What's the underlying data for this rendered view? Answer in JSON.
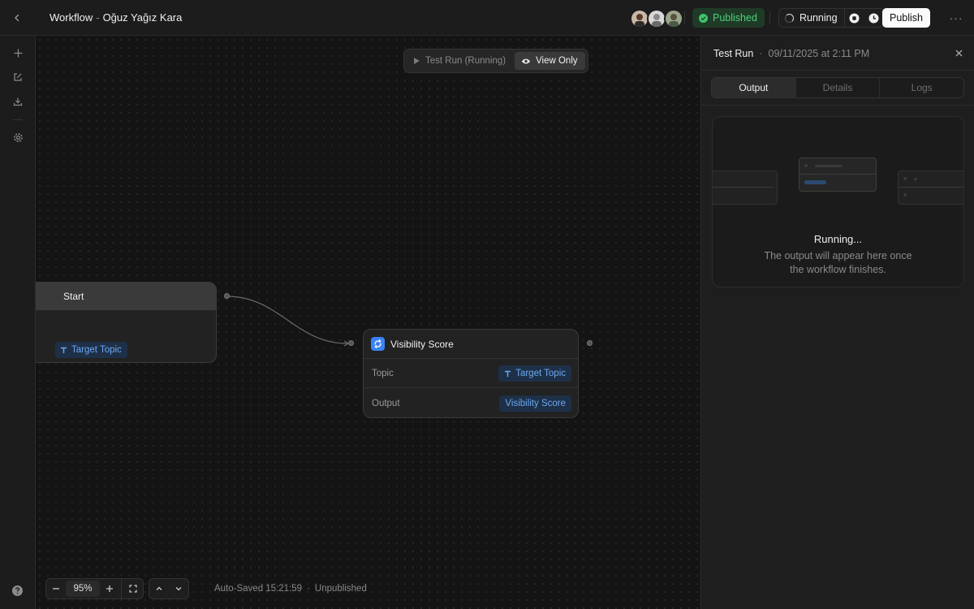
{
  "header": {
    "title_prefix": "Workflow",
    "title_separator": "-",
    "title_user": "Oğuz Yağız Kara",
    "published_label": "Published",
    "running_label": "Running",
    "publish_label": "Publish",
    "more_label": "···"
  },
  "canvas_toolbar": {
    "test_run_label": "Test Run (Running)",
    "view_only_label": "View Only"
  },
  "nodes": {
    "start": {
      "title": "Start",
      "output_pill": "Target Topic"
    },
    "visibility_score": {
      "title": "Visibility Score",
      "rows": [
        {
          "label": "Topic",
          "value": "Target Topic"
        },
        {
          "label": "Output",
          "value": "Visibility Score"
        }
      ]
    }
  },
  "bottom": {
    "zoom": "95%",
    "auto_saved": "Auto-Saved 15:21:59",
    "separator": "·",
    "status": "Unpublished"
  },
  "panel": {
    "title": "Test Run",
    "separator": "·",
    "date": "09/11/2025 at 2:11 PM",
    "tabs": [
      {
        "label": "Output",
        "active": true
      },
      {
        "label": "Details",
        "active": false
      },
      {
        "label": "Logs",
        "active": false
      }
    ],
    "output_title": "Running...",
    "output_desc_line1": "The output will appear here once",
    "output_desc_line2": "the workflow finishes."
  },
  "colors": {
    "accent_green": "#3fc46a",
    "pill_blue": "#6ca8f0",
    "node_icon_blue": "#3b82f6"
  }
}
